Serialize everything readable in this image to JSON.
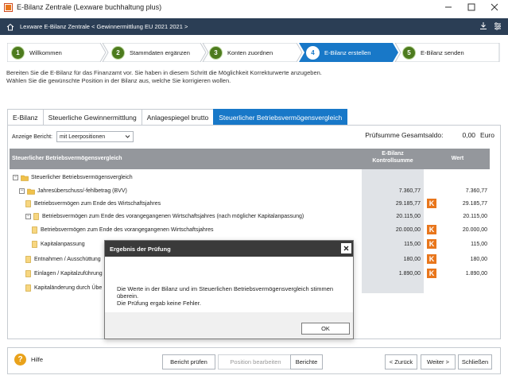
{
  "window": {
    "title": "E-Bilanz Zentrale (Lexware buchhaltung plus)"
  },
  "nav": {
    "breadcrumb": "Lexware E-Bilanz Zentrale < Gewinnermittlung EU 2021 2021 >"
  },
  "steps": [
    {
      "num": "1",
      "label": "Willkommen",
      "state": "done"
    },
    {
      "num": "2",
      "label": "Stammdaten ergänzen",
      "state": "done"
    },
    {
      "num": "3",
      "label": "Konten zuordnen",
      "state": "done"
    },
    {
      "num": "4",
      "label": "E-Bilanz erstellen",
      "state": "active"
    },
    {
      "num": "5",
      "label": "E-Bilanz senden",
      "state": "todo"
    }
  ],
  "intro": {
    "line1": "Bereiten Sie die E-Bilanz für das Finanzamt vor. Sie haben in diesem Schritt die Möglichkeit Korrekturwerte anzugeben.",
    "line2": "Wählen Sie die gewünschte Position in der Bilanz aus, welche Sie korrigieren wollen."
  },
  "tabs": [
    {
      "label": "E-Bilanz",
      "active": false
    },
    {
      "label": "Steuerliche Gewinnermittlung",
      "active": false
    },
    {
      "label": "Anlagespiegel brutto",
      "active": false
    },
    {
      "label": "Steuerlicher Betriebsvermögensvergleich",
      "active": true
    }
  ],
  "report": {
    "label": "Anzeige Bericht:",
    "selected": "mit Leerpositionen"
  },
  "pruefsumme": {
    "label": "Prüfsumme Gesamtsaldo:",
    "value": "0,00",
    "unit": "Euro"
  },
  "table": {
    "col_name": "Steuerlicher Betriebsvermögensvergleich",
    "col_ctrl_line1": "E-Bilanz",
    "col_ctrl_line2": "Kontrollsumme",
    "col_value": "Wert",
    "rows": [
      {
        "toggle": "−",
        "icon": "folder",
        "label": "Steuerlicher Betriebsvermögensvergleich",
        "ctrl": "",
        "k": false,
        "value": ""
      },
      {
        "toggle": "−",
        "icon": "folder",
        "label": "Jahresüberschuss/-fehlbetrag (BVV)",
        "ctrl": "7.360,77",
        "k": false,
        "value": "7.360,77"
      },
      {
        "toggle": "",
        "icon": "doc",
        "label": "Betriebsvermögen zum Ende des Wirtschaftsjahres",
        "ctrl": "29.185,77",
        "k": true,
        "value": "29.185,77"
      },
      {
        "toggle": "−",
        "icon": "doc",
        "label": "Betriebsvermögen zum Ende des vorangegangenen Wirtschaftsjahres (nach möglicher Kapitalanpassung)",
        "ctrl": "20.115,00",
        "k": false,
        "value": "20.115,00"
      },
      {
        "toggle": "",
        "icon": "doc",
        "label": "Betriebsvermögen zum Ende des vorangegangenen Wirtschaftsjahres",
        "ctrl": "20.000,00",
        "k": true,
        "value": "20.000,00"
      },
      {
        "toggle": "",
        "icon": "doc",
        "label": "Kapitalanpassung",
        "ctrl": "115,00",
        "k": true,
        "value": "115,00"
      },
      {
        "toggle": "",
        "icon": "doc",
        "label": "Entnahmen / Ausschüttung",
        "ctrl": "180,00",
        "k": true,
        "value": "180,00"
      },
      {
        "toggle": "",
        "icon": "doc",
        "label": "Einlagen / Kapitalzuführung",
        "ctrl": "1.890,00",
        "k": true,
        "value": "1.890,00"
      },
      {
        "toggle": "",
        "icon": "doc",
        "label": "Kapitaländerung durch Übe",
        "ctrl": "",
        "k": false,
        "value": ""
      }
    ]
  },
  "k_label": "K",
  "bottom": {
    "help": "Hilfe",
    "bericht_pruefen": "Bericht prüfen",
    "position_bearbeiten": "Position bearbeiten",
    "berichte": "Berichte",
    "zurueck": "< Zurück",
    "weiter": "Weiter >",
    "schliessen": "Schließen"
  },
  "dialog": {
    "title": "Ergebnis der Prüfung",
    "message1": "Die Werte in der Bilanz und im Steuerlichen Betriebsvermögensvergleich stimmen überein.",
    "message2": "Die Prüfung ergab keine Fehler.",
    "ok": "OK"
  },
  "colors": {
    "navbar": "#2b3e55",
    "step_active": "#1878c8",
    "tab_active": "#1878c8",
    "k_badge": "#e8761c",
    "step_num": "#4d7b1e"
  }
}
